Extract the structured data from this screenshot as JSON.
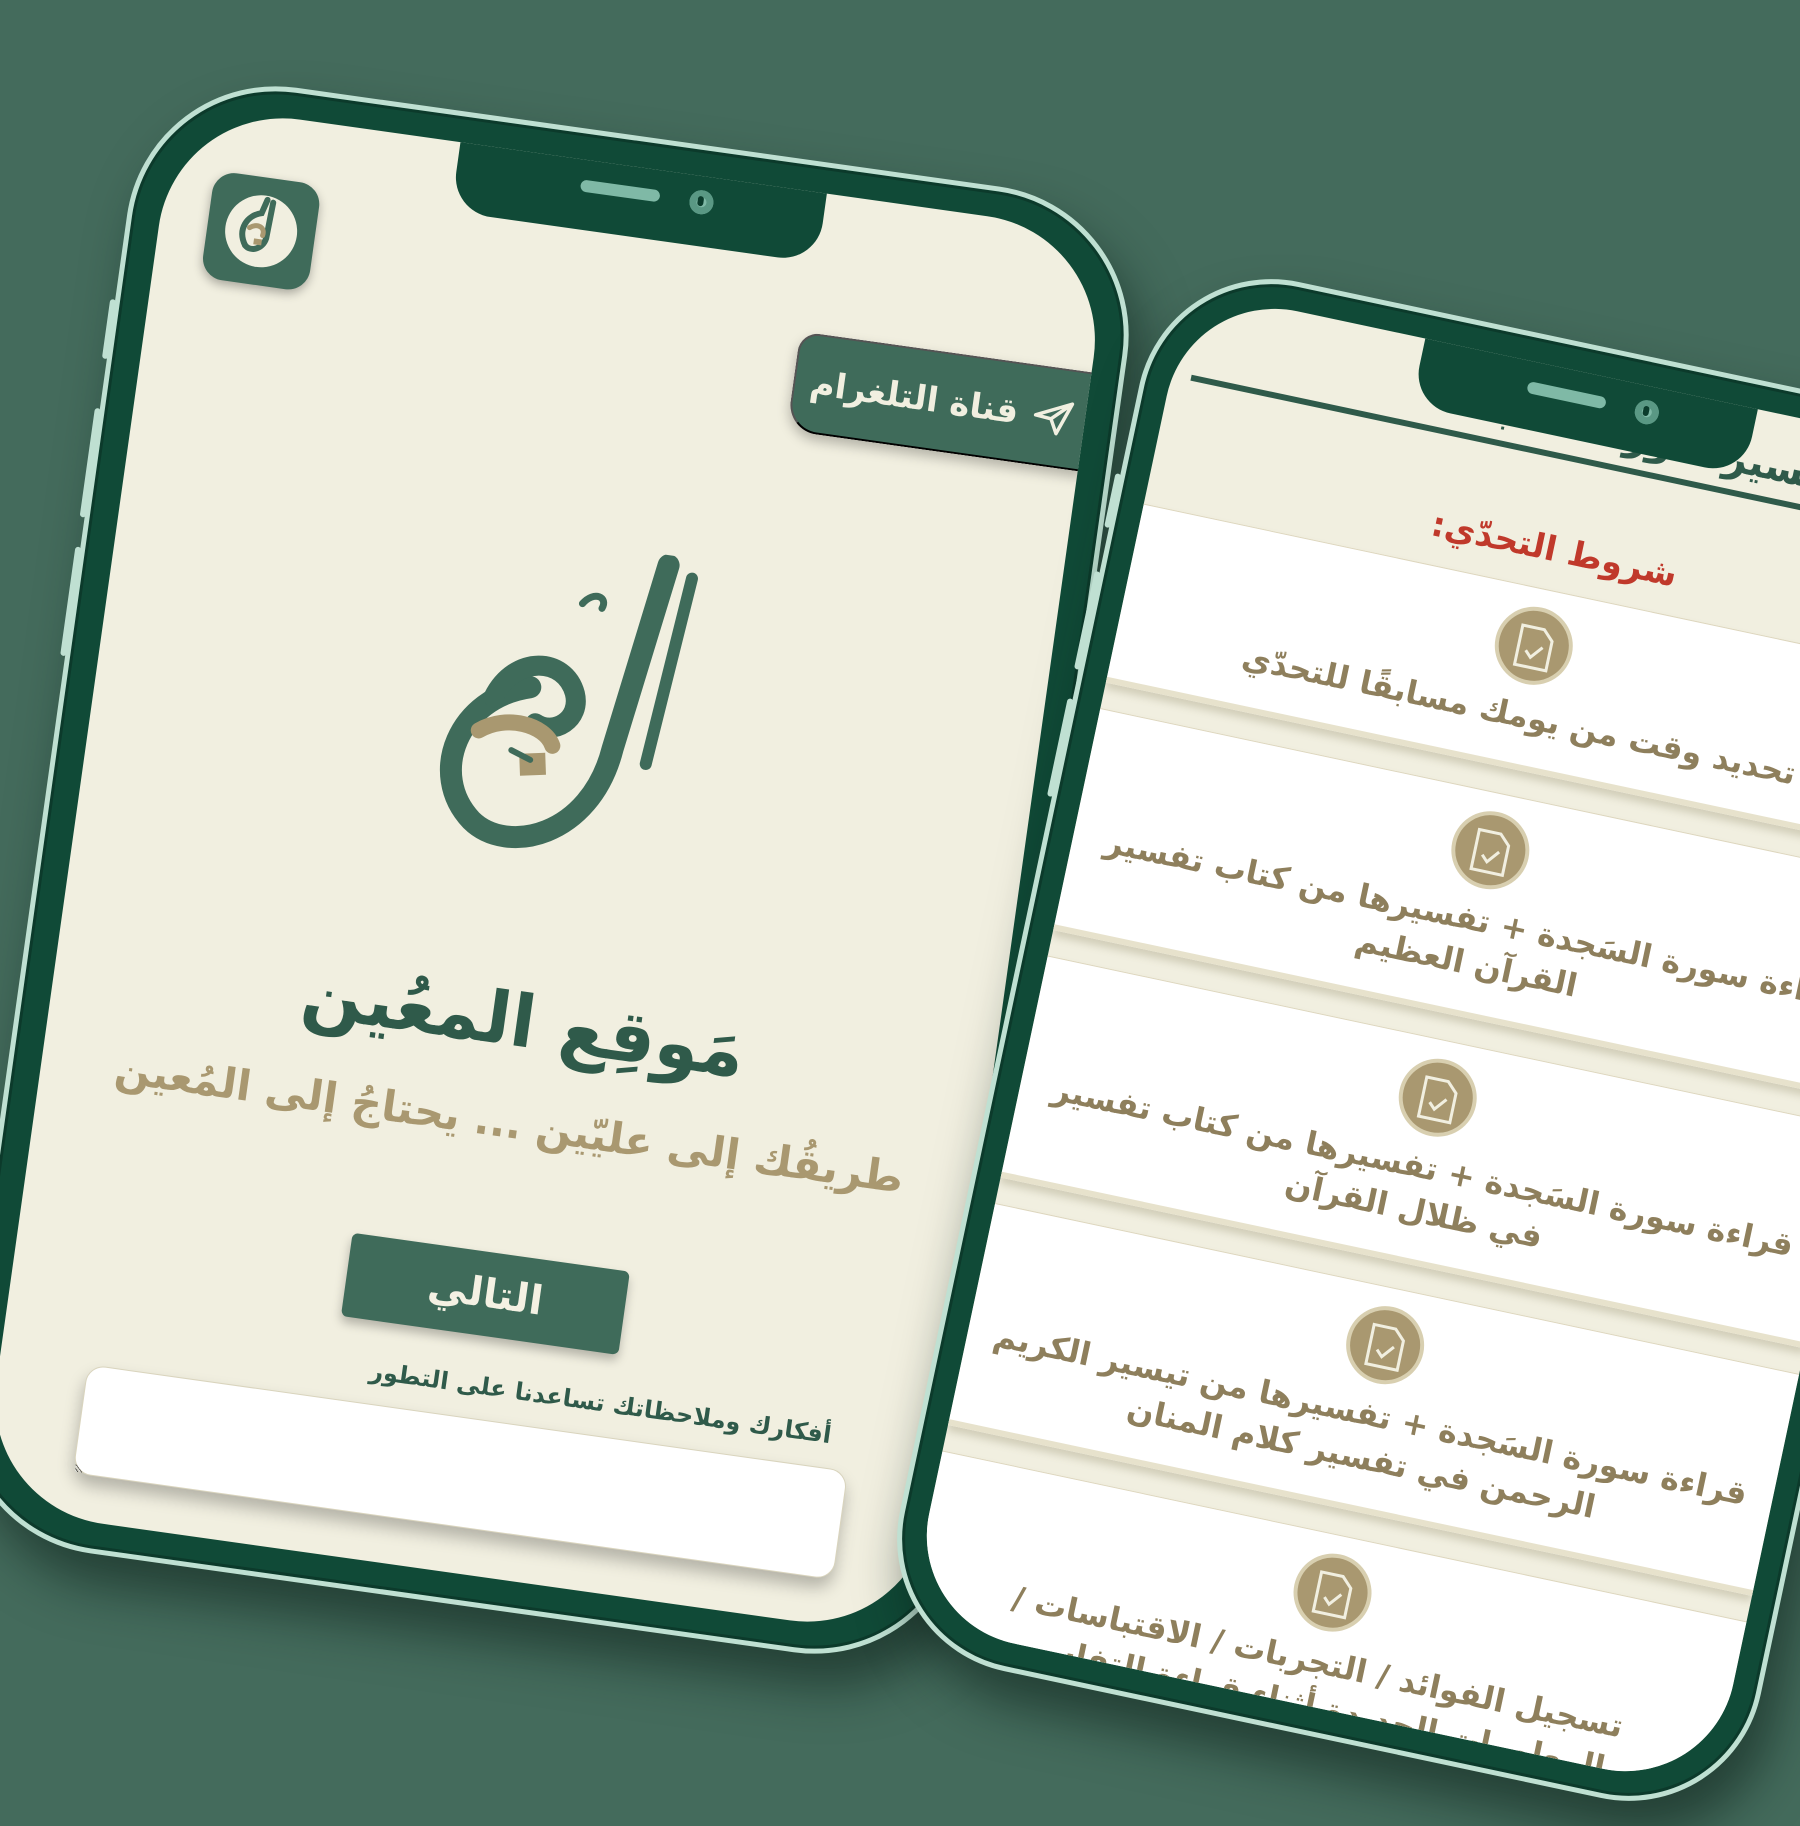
{
  "left_screen": {
    "telegram_button": "قناة التلغرام",
    "app_icon_name": "almuin-logo-icon",
    "logo_name": "almuin-calligraphy-logo",
    "site_title": "مَوقِع المعُين",
    "tagline": "طريقُك إلى عليّين ... يحتاجُ إلى المُعين",
    "next_button": "التالي",
    "feedback_label": "أفكارك وملاحظاتك تساعدنا على التطور",
    "feedback_value": ""
  },
  "right_screen": {
    "challenge_title": "تحدّي تفسير سورة السجدة",
    "conditions_title": "شروط التحدّي:",
    "conditions": [
      {
        "text": "تحديد وقت من يومك مسابقًا للتحدّي",
        "icon": "document-check-icon"
      },
      {
        "text": "قراءة سورة السَجدة + تفسيرها من كتاب تفسير القرآن العظيم",
        "icon": "document-check-icon"
      },
      {
        "text": "قراءة سورة السَجدة + تفسيرها من كتاب تفسير في ظلال القرآن",
        "icon": "document-check-icon"
      },
      {
        "text": "قراءة سورة السَجدة + تفسيرها من تيسير الكريم الرحمن في تفسير كلام المنان",
        "icon": "document-check-icon"
      },
      {
        "text": "تسجيل الفوائد / التجربات / الاقتباسات / المعلومات الجديدة أثناء قراءة التفاسير",
        "icon": "document-check-icon"
      }
    ]
  },
  "colors": {
    "background": "#446b5c",
    "phone_frame": "#104a37",
    "screen_bg": "#f1efe0",
    "primary_green": "#3f6b5a",
    "gold": "#a99870",
    "red_heading": "#c0392b"
  }
}
